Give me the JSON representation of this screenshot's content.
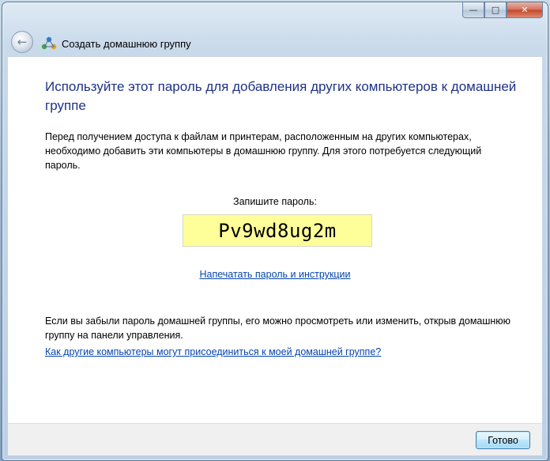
{
  "window": {
    "title": "Создать домашнюю группу",
    "minimize_glyph": "—",
    "maximize_glyph": "□",
    "close_glyph": "✕",
    "back_glyph": "←"
  },
  "content": {
    "heading": "Используйте этот пароль для добавления других компьютеров к домашней группе",
    "intro": "Перед получением доступа к файлам и принтерам, расположенным на других компьютерах, необходимо добавить эти компьютеры в домашнюю группу. Для этого потребуется следующий пароль.",
    "password_label": "Запишите пароль:",
    "password": "Pv9wd8ug2m",
    "print_link": "Напечатать пароль и инструкции",
    "forgot_text": "Если вы забыли пароль домашней группы, его можно просмотреть или изменить, открыв домашнюю группу на панели управления.",
    "help_link": "Как другие компьютеры могут присоединиться к моей домашней группе?"
  },
  "footer": {
    "done_label": "Готово"
  },
  "colors": {
    "heading": "#1e3287",
    "link": "#0645ad",
    "password_bg": "#ffff99"
  },
  "icons": {
    "back": "back-arrow-icon",
    "homegroup": "homegroup-icon"
  }
}
